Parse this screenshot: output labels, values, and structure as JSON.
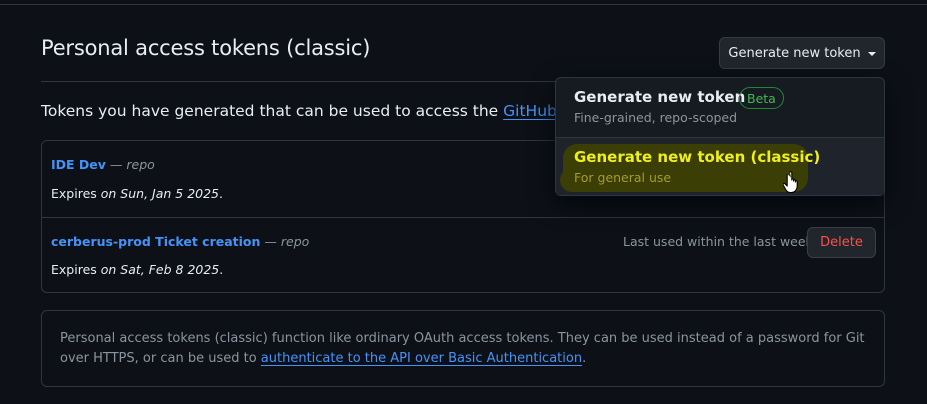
{
  "page": {
    "title": "Personal access tokens (classic)",
    "generate_button_label": "Generate new token",
    "intro_text": "Tokens you have generated that can be used to access the ",
    "intro_link": "GitHub API",
    "intro_end": "."
  },
  "tokens": [
    {
      "name": "IDE Dev",
      "dash": " — ",
      "scope": "repo",
      "expires_prefix": "Expires ",
      "expires_date": "on Sun, Jan 5 2025",
      "expires_suffix": "."
    },
    {
      "name": "cerberus-prod Ticket creation",
      "dash": " — ",
      "scope": "repo",
      "expires_prefix": "Expires ",
      "expires_date": "on Sat, Feb 8 2025",
      "expires_suffix": ".",
      "last_used": "Last used within the last week",
      "delete_label": "Delete"
    }
  ],
  "info": {
    "text": "Personal access tokens (classic) function like ordinary OAuth access tokens. They can be used instead of a password for Git over HTTPS, or can be used to ",
    "link": "authenticate to the API over Basic Authentication",
    "end": "."
  },
  "dropdown": {
    "items": [
      {
        "title": "Generate new token",
        "badge": "Beta",
        "subtitle": "Fine-grained, repo-scoped"
      },
      {
        "title": "Generate new token (classic)",
        "subtitle": "For general use"
      }
    ]
  },
  "colors": {
    "background": "#0d1117",
    "link": "#4493f8",
    "danger": "#f85149",
    "success": "#3fb950",
    "highlight": "#f0ef1e"
  },
  "icons": {
    "caret": "caret-down-icon",
    "cursor": "hand-pointer-icon"
  }
}
